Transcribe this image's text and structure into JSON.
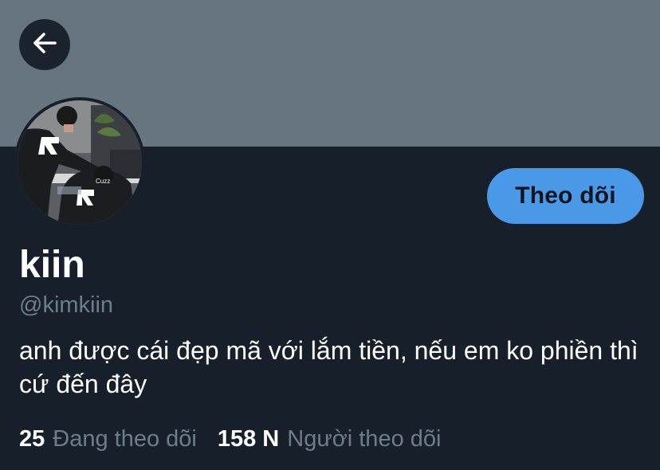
{
  "header": {
    "back_icon": "arrow-left-icon",
    "banner_color": "#66757f"
  },
  "profile": {
    "display_name": "kiin",
    "handle": "@kimkiin",
    "bio": "anh được cái đẹp mã với lắm tiền, nếu em ko phiền thì cứ đến đây",
    "avatar_text": "Cuzz"
  },
  "actions": {
    "follow_label": "Theo dõi",
    "follow_color": "#4a99e9"
  },
  "stats": {
    "following_count": "25",
    "following_label": "Đang theo dõi",
    "followers_count": "158 N",
    "followers_label": "Người theo dõi"
  },
  "colors": {
    "background": "#17202a",
    "secondary_text": "#6e7d8a"
  }
}
